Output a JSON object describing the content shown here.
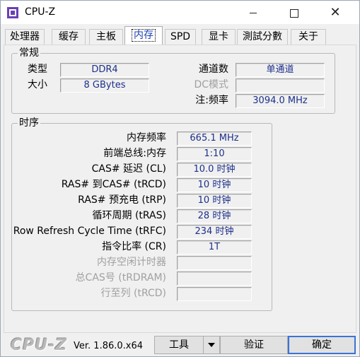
{
  "app": {
    "title": "CPU-Z",
    "brand": "CPU-Z",
    "version": "Ver. 1.86.0.x64"
  },
  "tabs": [
    {
      "label": "处理器"
    },
    {
      "label": "缓存"
    },
    {
      "label": "主板"
    },
    {
      "label": "内存",
      "active": true
    },
    {
      "label": "SPD"
    },
    {
      "label": "显卡"
    },
    {
      "label": "測試分數"
    },
    {
      "label": "关于"
    }
  ],
  "general": {
    "title": "常规",
    "type_label": "类型",
    "type_value": "DDR4",
    "size_label": "大小",
    "size_value": "8 GBytes",
    "channels_label": "通道数",
    "channels_value": "单通道",
    "dc_mode_label": "DC模式",
    "dc_mode_value": "",
    "nb_freq_label": "注:频率",
    "nb_freq_value": "3094.0 MHz"
  },
  "timings": {
    "title": "时序",
    "rows": [
      {
        "label": "内存频率",
        "value": "665.1 MHz",
        "enabled": true
      },
      {
        "label": "前端总线:内存",
        "value": "1:10",
        "enabled": true
      },
      {
        "label": "CAS# 延迟 (CL)",
        "value": "10.0 时钟",
        "enabled": true
      },
      {
        "label": "RAS# 到CAS# (tRCD)",
        "value": "10 时钟",
        "enabled": true
      },
      {
        "label": "RAS# 预充电 (tRP)",
        "value": "10 时钟",
        "enabled": true
      },
      {
        "label": "循环周期 (tRAS)",
        "value": "28 时钟",
        "enabled": true
      },
      {
        "label": "Row Refresh Cycle Time (tRFC)",
        "value": "234 时钟",
        "enabled": true
      },
      {
        "label": "指令比率 (CR)",
        "value": "1T",
        "enabled": true
      },
      {
        "label": "内存空闲计时器",
        "value": "",
        "enabled": false
      },
      {
        "label": "总CAS号 (tRDRAM)",
        "value": "",
        "enabled": false
      },
      {
        "label": "行至列 (tRCD)",
        "value": "",
        "enabled": false
      }
    ]
  },
  "footer": {
    "tools_label": "工具",
    "validate_label": "验证",
    "ok_label": "确定"
  }
}
